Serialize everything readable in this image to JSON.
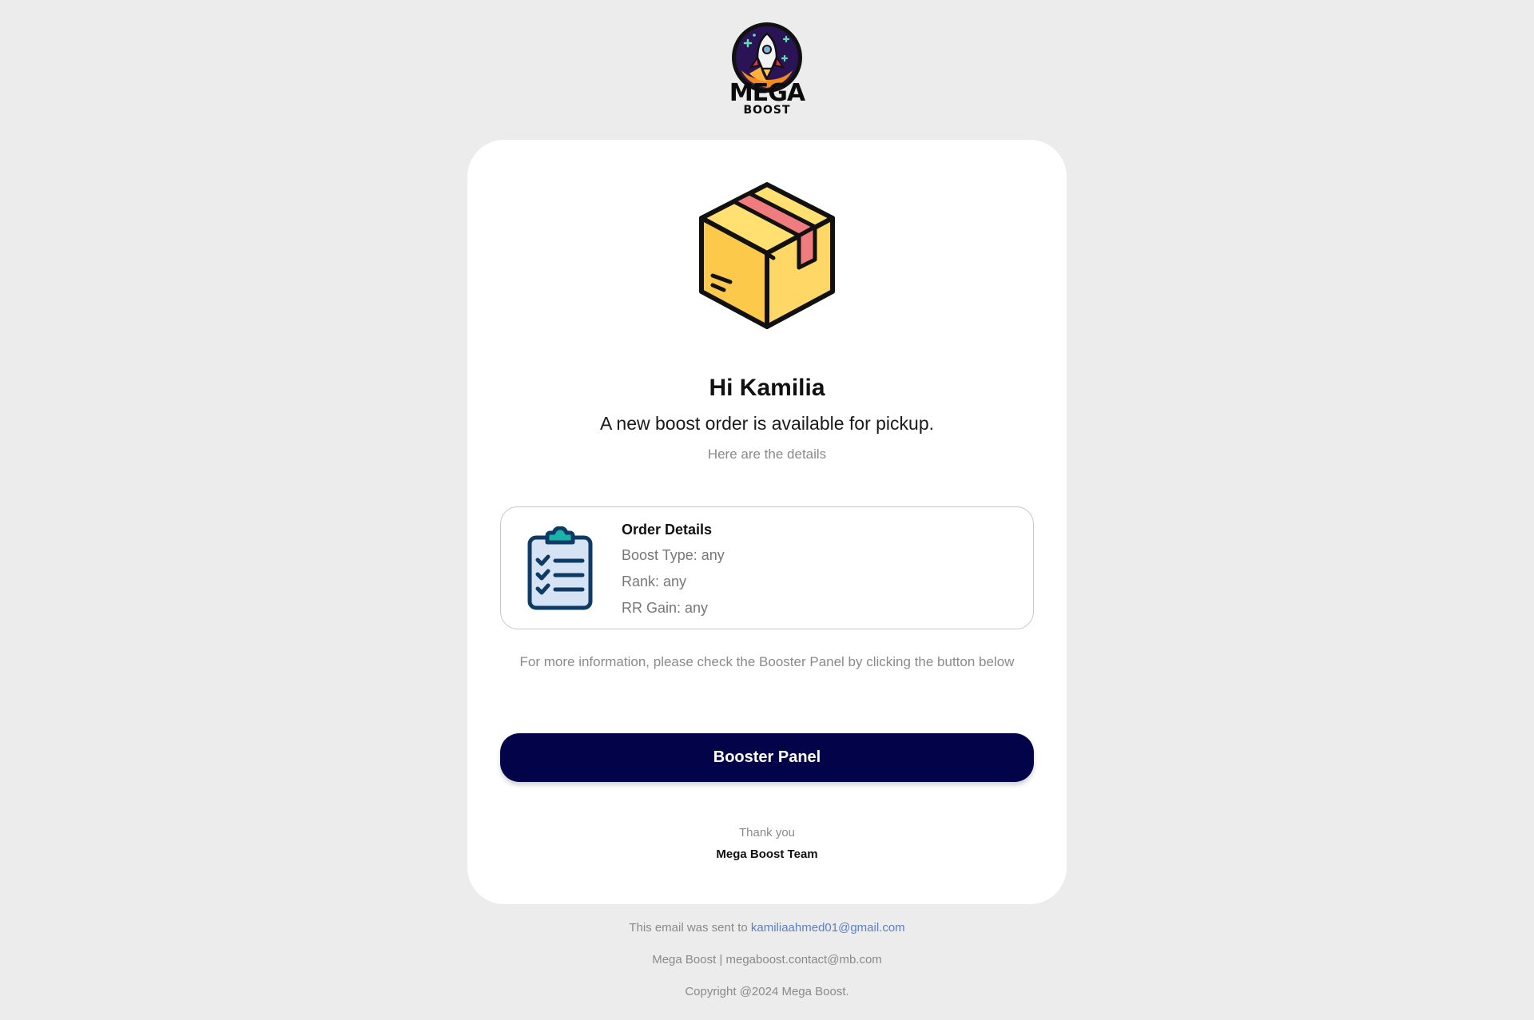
{
  "brand": {
    "logo_word": "MEGA",
    "logo_sub": "BOOST"
  },
  "email": {
    "greeting": "Hi Kamilia",
    "headline": "A new boost order is available for pickup.",
    "subline": "Here are the details",
    "details": {
      "title": "Order Details",
      "lines": [
        "Boost Type: any",
        "Rank: any",
        "RR Gain: any"
      ]
    },
    "more_info": "For more information, please check the Booster Panel by clicking the button below",
    "button_label": "Booster Panel",
    "thanks": "Thank you",
    "signature": "Mega Boost Team"
  },
  "footer": {
    "sent_prefix": "This email was sent to",
    "recipient": "kamiliaahmed01@gmail.com",
    "contact": "Mega Boost | megaboost.contact@mb.com",
    "copyright": "Copyright @2024 Mega Boost."
  },
  "colors": {
    "background": "#ececec",
    "card": "#ffffff",
    "button": "#03034a",
    "link": "#5b7fc4",
    "muted_text": "#8a8a8a"
  },
  "icons": [
    "rocket-logo-icon",
    "package-box-icon",
    "clipboard-checklist-icon"
  ]
}
